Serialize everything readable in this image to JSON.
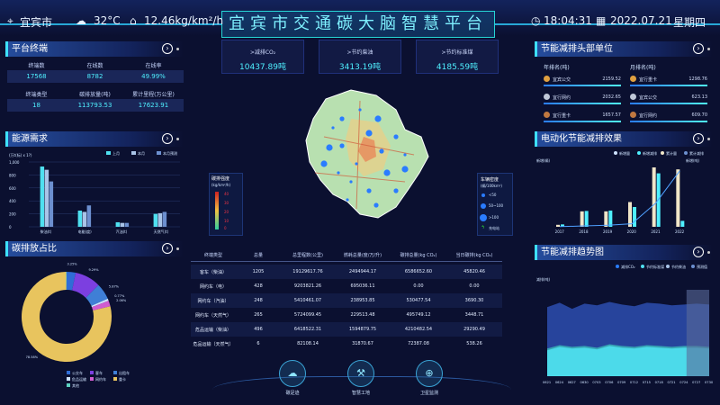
{
  "header": {
    "title": "宜宾市交通碳大脑智慧平台",
    "city": "宜宾市",
    "temp": "32°C",
    "emission": "12.46kg/km²/h",
    "time": "18:04:31",
    "date": "2022.07.21",
    "weekday": "星期四"
  },
  "stats": [
    {
      "label": ">减排CO₂",
      "value": "10437.89吨"
    },
    {
      "label": ">节约柴油",
      "value": "3413.19吨"
    },
    {
      "label": ">节约标准煤",
      "value": "4185.59吨"
    }
  ],
  "terminal": {
    "title": "平台终端",
    "r1": [
      "终端数",
      "在线数",
      "在线率"
    ],
    "v1": [
      "17568",
      "8782",
      "49.99%"
    ],
    "r2": [
      "终端类型",
      "碳排放量(吨)",
      "累计里程(万公里)"
    ],
    "v2": [
      "18",
      "113793.53",
      "17623.91"
    ]
  },
  "energy": {
    "title": "能源需求",
    "legend": [
      "上月",
      "本月",
      "本月预测"
    ],
    "yunit": "(万t(标) x 1?)",
    "yticks": [
      "1,000",
      "800",
      "600",
      "400",
      "200",
      "0"
    ],
    "cats": [
      "柴油(t)",
      "汽油(t)",
      "天然气(t)"
    ],
    "chart_data": {
      "type": "bar",
      "categories": [
        "柴油(t)",
        "电能(度)",
        "汽油(t)",
        "天然气(t)"
      ],
      "ylim": [
        0,
        1000
      ],
      "series": [
        {
          "name": "上月",
          "values": [
            930,
            250,
            70,
            200
          ]
        },
        {
          "name": "本月",
          "values": [
            880,
            230,
            60,
            210
          ]
        },
        {
          "name": "本月预测",
          "values": [
            700,
            330,
            60,
            230
          ]
        }
      ]
    }
  },
  "carbon": {
    "title": "碳排放占比",
    "legend": [
      "公交车",
      "客车",
      "出租车",
      "危品运输",
      "网约车",
      "重卡",
      "其他"
    ],
    "chart_data": {
      "type": "pie",
      "labels": [
        "公交车",
        "客车",
        "出租车",
        "危品运输",
        "网约车",
        "重卡",
        "其他"
      ],
      "values": [
        3.25,
        9.29,
        5.87,
        0.77,
        2.06,
        78.58,
        0.18
      ],
      "colors": [
        "#2f6cd6",
        "#7c3fe0",
        "#3f7fd6",
        "#cfe3ff",
        "#d05cd0",
        "#e8c45e",
        "#5cd0c0"
      ],
      "pct_labels": [
        "3.25%",
        "9.29%",
        "5.87%",
        "0.77%",
        "2.06%",
        "78.58%"
      ]
    }
  },
  "map": {
    "legend_title": "碳排强度",
    "legend_unit": "(kg/km²/h)",
    "legend_ticks": [
      "40",
      "30",
      "20",
      "10",
      "0"
    ],
    "density_title": "车辆密度",
    "density_unit": "(辆/100km²)",
    "density": [
      "<50",
      "50~100",
      ">100",
      "充电站"
    ]
  },
  "table": {
    "headers": [
      "终端类型",
      "总量",
      "总里程数(公里)",
      "燃耗总量(度/万/升)",
      "碳排总量(kg CO₂)",
      "当日碳排(kg CO₂)"
    ],
    "rows": [
      [
        "客车（柴油）",
        "1205",
        "19129617.76",
        "2494944.17",
        "6586652.60",
        "45820.46"
      ],
      [
        "网约车（电）",
        "428",
        "9203821.26",
        "695036.11",
        "0.00",
        "0.00"
      ],
      [
        "网约车（汽油）",
        "248",
        "5410461.07",
        "238953.85",
        "530477.54",
        "3690.30"
      ],
      [
        "网约车（天然气）",
        "265",
        "5724099.45",
        "229513.48",
        "495749.12",
        "3448.71"
      ],
      [
        "危品运输（柴油）",
        "496",
        "6418522.31",
        "1594879.75",
        "4210482.54",
        "29290.49"
      ],
      [
        "危品运输（天然气）",
        "6",
        "82108.14",
        "31870.67",
        "72387.08",
        "538.26"
      ]
    ]
  },
  "buttons": [
    "碳足迹",
    "智慧工地",
    "卫星监测"
  ],
  "ranking": {
    "title": "节能减排头部单位",
    "sub1": "年排名(吨)",
    "sub2": "月排名(吨)",
    "left": [
      {
        "name": "宜宾公交",
        "value": "2159.52"
      },
      {
        "name": "宜行网约",
        "value": "2032.65"
      },
      {
        "name": "宜行重卡",
        "value": "1657.57"
      }
    ],
    "right": [
      {
        "name": "宜行重卡",
        "value": "1298.76"
      },
      {
        "name": "宜宾公交",
        "value": "623.13"
      },
      {
        "name": "宜行网约",
        "value": "609.70"
      }
    ]
  },
  "electric": {
    "title": "电动化节能减排效果",
    "legend": [
      "新增量",
      "新增减排",
      "累计量",
      "累计减排"
    ],
    "yunit_left": "新增(辆)",
    "yunit_right": "新增(吨)",
    "chart_data": {
      "type": "bar",
      "categories": [
        "2017",
        "2018",
        "2019",
        "2020",
        "2021",
        "2022"
      ],
      "ylim": [
        0,
        3000
      ],
      "series": [
        {
          "name": "新增量",
          "values": [
            100,
            780,
            780,
            1250,
            3000,
            2900
          ]
        },
        {
          "name": "累计量",
          "values": [
            120,
            800,
            820,
            1000,
            2700,
            300
          ]
        }
      ],
      "y2lim": [
        0,
        35000
      ],
      "line": [
        100,
        500,
        900,
        1800,
        14000,
        33000
      ]
    }
  },
  "trend": {
    "title": "节能减排趋势图",
    "legend": [
      "减排CO₂",
      "节约标准煤",
      "节约柴油",
      "预测值"
    ],
    "yunit": "减排(吨)",
    "chart_data": {
      "type": "area",
      "x": [
        "0621",
        "0624",
        "0627",
        "0630",
        "0703",
        "0706",
        "0709",
        "0712",
        "0715",
        "0718",
        "0721",
        "0724",
        "0727",
        "0730"
      ],
      "ylim": [
        0,
        100
      ],
      "series": [
        {
          "name": "减排CO₂",
          "values": [
            80,
            85,
            78,
            84,
            82,
            86,
            83,
            81,
            85,
            84,
            82,
            83,
            84,
            83
          ]
        },
        {
          "name": "节约标准煤",
          "values": [
            32,
            36,
            34,
            35,
            33,
            37,
            35,
            34,
            36,
            35,
            34,
            35,
            35,
            34
          ]
        },
        {
          "name": "节约柴油",
          "values": [
            30,
            34,
            32,
            33,
            31,
            35,
            33,
            32,
            34,
            33,
            32,
            33,
            33,
            32
          ]
        }
      ]
    }
  }
}
